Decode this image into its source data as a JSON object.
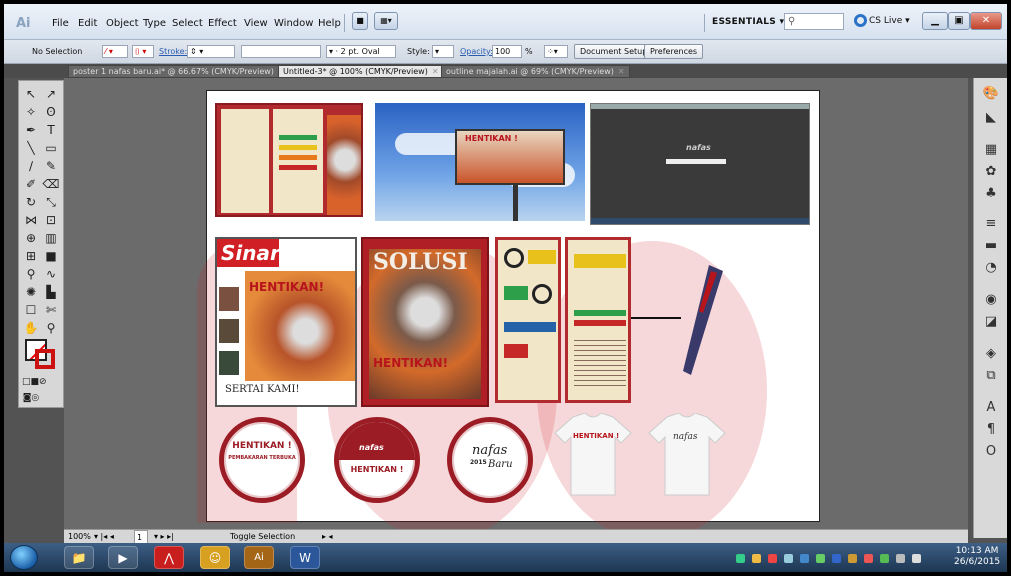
{
  "app": {
    "logo": "Ai"
  },
  "menu": [
    "File",
    "Edit",
    "Object",
    "Type",
    "Select",
    "Effect",
    "View",
    "Window",
    "Help"
  ],
  "workspace": {
    "label": "ESSENTIALS ▾"
  },
  "cs_live": "CS Live ▾",
  "control_bar": {
    "selection": "No Selection",
    "stroke_label": "Stroke:",
    "brush": "2 pt. Oval",
    "style_label": "Style:",
    "opacity_label": "Opacity:",
    "opacity_value": "100",
    "opacity_unit": "%",
    "document_setup": "Document Setup",
    "preferences": "Preferences"
  },
  "tabs": [
    {
      "label": "poster 1 nafas baru.ai* @ 66.67% (CMYK/Preview)"
    },
    {
      "label": "Untitled-3* @ 100% (CMYK/Preview)"
    },
    {
      "label": "outline majalah.ai @ 69% (CMYK/Preview)"
    }
  ],
  "artwork": {
    "billboard_text": "HENTIKAN !",
    "newspaper_name": "Sinar",
    "newspaper_headline": "HENTIKAN!",
    "newspaper_footer": "SERTAI KAMI!",
    "magazine_title": "SOLUSI",
    "magazine_headline": "HENTIKAN!",
    "badge1_title": "HENTIKAN !",
    "badge1_sub": "PEMBAKARAN TERBUKA",
    "badge2_title": "HENTIKAN !",
    "badge2_brand": "nafas",
    "badge3_brand": "nafas",
    "badge3_year": "2015",
    "badge3_sub": "Baru",
    "shirt1_text": "HENTIKAN !",
    "shirt2_text": "nafas",
    "screen_logo": "nafas"
  },
  "status": {
    "zoom": "100%",
    "page": "1",
    "mode": "Toggle Selection"
  },
  "clock": {
    "time": "10:13 AM",
    "date": "26/6/2015"
  },
  "colors": {
    "brand_red": "#9b1c24",
    "fire": "#d9622b"
  }
}
